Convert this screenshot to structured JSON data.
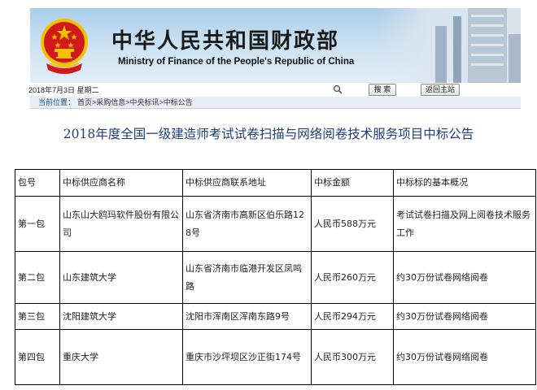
{
  "header": {
    "title_cn": "中华人民共和国财政部",
    "title_en": "Ministry of Finance of the People's Republic of China",
    "logo": "national-emblem"
  },
  "toolbar": {
    "date": "2018年7月3日  星期二",
    "search_icon": "search-icon",
    "search_button": "搜  索",
    "home_button": "返回主站"
  },
  "breadcrumb": {
    "label": "当前位置：",
    "path": "首页>采购信息>中央标讯>中标公告"
  },
  "article": {
    "title": "2018年度全国一级建造师考试试卷扫描与网络阅卷技术服务项目中标公告"
  },
  "table": {
    "headers": [
      "包号",
      "中标供应商名称",
      "中标供应商联系地址",
      "中标金额",
      "中标标的基本概况"
    ],
    "rows": [
      [
        "第一包",
        "山东山大鸥玛软件股份有限公司",
        "山东省济南市高新区伯乐路128号",
        "人民币588万元",
        "考试试卷扫描及网上阅卷技术服务工作"
      ],
      [
        "第二包",
        "山东建筑大学",
        "山东省济南市临港开发区凤鸣路",
        "人民币260万元",
        "约30万份试卷网络阅卷"
      ],
      [
        "第三包",
        "沈阳建筑大学",
        "沈阳市浑南区浑南东路9号",
        "人民币294万元",
        "约30万份试卷网络阅卷"
      ],
      [
        "第四包",
        "重庆大学",
        "重庆市沙坪坝区沙正街174号",
        "人民币300万元",
        "约30万份试卷网络阅卷"
      ]
    ]
  },
  "colors": {
    "title": "#1a3e7a",
    "breadcrumb_label": "#1f4f8f",
    "emblem_red": "#d11a1a",
    "emblem_gold": "#f2c200"
  }
}
